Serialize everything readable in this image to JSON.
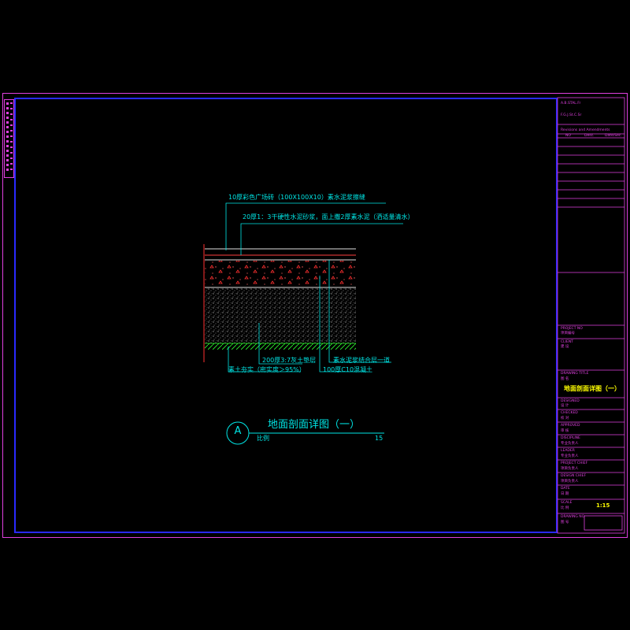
{
  "drawing": {
    "callouts": {
      "tile": "10厚彩色广场砖（100X100X10）素水泥浆擦缝",
      "mortar": "20厚1：3干硬性水泥砂浆，面上撒2厚素水泥（洒适量清水）",
      "cement_paste": "素水泥浆结合层一道",
      "concrete": "100厚C10混凝土",
      "lime_soil": "200厚3:7灰土垫层",
      "subgrade": "素土夯实（密实度＞95%）"
    },
    "detail_marker": "A",
    "detail_title": "地面剖面详图（一）",
    "scale_label": "比例",
    "scale_value": "15"
  },
  "title_block": {
    "header_line1": "A.B.STAL.Fr",
    "header_line2": "F.G.J.St.C.Sr",
    "revisions_label": "Revisions and Amendments",
    "rev_col1": "NO",
    "rev_col2": "Desc.",
    "rev_col3": "Date/Sec.",
    "project_no_label_en": "PROJECT NO",
    "project_no_label": "项目编号",
    "client_label_en": "CLIENT",
    "client_label": "建 设",
    "drawing_title_label_en": "DRAWING TITLE",
    "drawing_title_label": "图 名",
    "drawing_title": "地面剖面详图（一）",
    "design_label_en": "DESIGNED",
    "design_label": "设 计",
    "check_label_en": "CHECKED",
    "check_label": "校 对",
    "approve_label_en": "APPROVED",
    "approve_label": "审 核",
    "discipline_label_en": "DISCIPLINE",
    "discipline_label": "专业负责人",
    "leader_label_en": "LEADER",
    "leader_label": "专业负责人",
    "project_chief_en": "PROJECT CHIEF",
    "project_chief": "项目负责人",
    "design_chief_en": "DESIGN CHIEF",
    "design_chief": "项目负责人",
    "date_label_en": "DATE",
    "date_label": "日 期",
    "scale_label_en": "SCALE",
    "scale_label": "比 例",
    "scale_value": "1:15",
    "drawing_no_label_en": "DRAWING NO",
    "drawing_no_label": "图 号"
  },
  "colors": {
    "frame": "#e040e0",
    "inner_border": "#2a2aff",
    "annotation": "#00e5e5",
    "concrete_fill": "#ff3030",
    "ground_hatch": "#30ff30",
    "highlight": "#ffff00"
  }
}
